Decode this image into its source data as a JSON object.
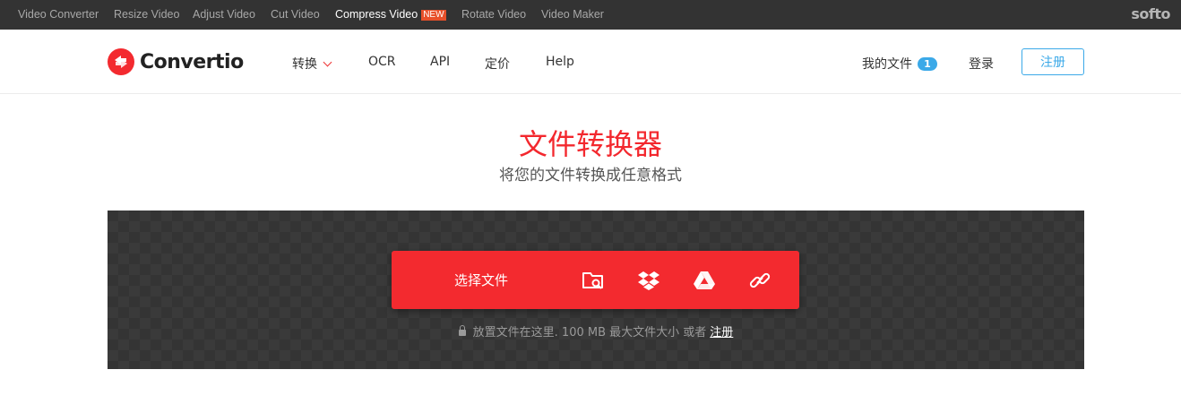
{
  "topbar": {
    "links": [
      "Video Converter",
      "Resize Video",
      "Adjust Video",
      "Cut Video",
      "Compress Video",
      "Rotate Video",
      "Video Maker"
    ],
    "active_index": 4,
    "new_badge": "NEW",
    "brand": "softo"
  },
  "header": {
    "logo_text": "Convertio",
    "nav": {
      "convert": "转换",
      "ocr": "OCR",
      "api": "API",
      "pricing": "定价",
      "help": "Help"
    },
    "my_files": "我的文件",
    "my_files_count": "1",
    "login": "登录",
    "signup": "注册"
  },
  "hero": {
    "title": "文件转换器",
    "subtitle": "将您的文件转换成任意格式"
  },
  "dropzone": {
    "choose_files": "选择文件",
    "note": "放置文件在这里. 100 MB 最大文件大小 或者",
    "note_link": "注册",
    "icons": [
      "folder-search-icon",
      "dropbox-icon",
      "google-drive-icon",
      "link-icon"
    ]
  },
  "colors": {
    "accent_red": "#f32a2f",
    "accent_blue": "#3ba9e8",
    "topbar_bg": "#333333",
    "dropzone_bg": "#343434"
  }
}
